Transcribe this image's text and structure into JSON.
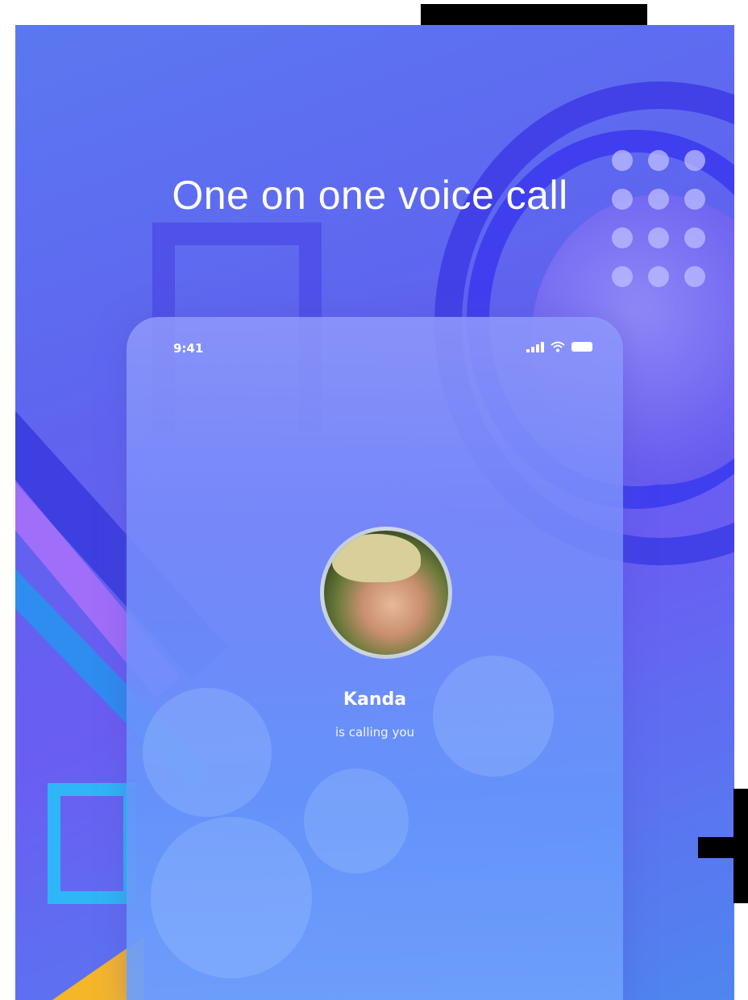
{
  "headline": "One on one voice call",
  "phone": {
    "status_time": "9:41",
    "caller_name": "Kanda",
    "caller_status": "is calling you"
  },
  "colors": {
    "background_blue": "#5f64ef",
    "ring_blue": "#3f3fe6",
    "accent_cyan": "#2fb6f6",
    "accent_yellow": "#f5b62a"
  },
  "icons": [
    "signal-icon",
    "wifi-icon",
    "battery-icon"
  ]
}
